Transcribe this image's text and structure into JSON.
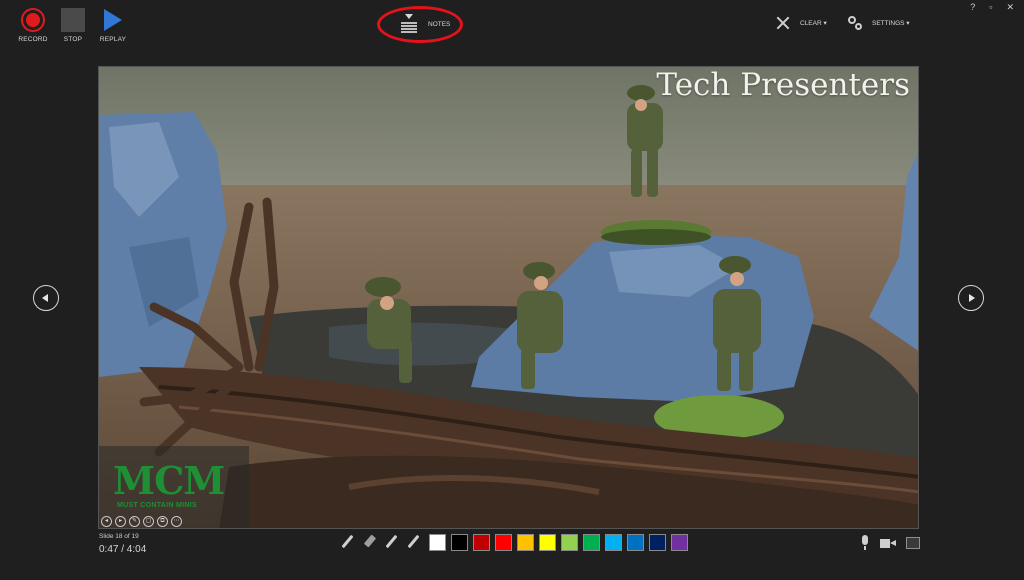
{
  "toolbar": {
    "record_label": "RECORD",
    "stop_label": "STOP",
    "replay_label": "REPLAY",
    "notes_label": "NOTES",
    "clear_label": "CLEAR ▾",
    "settings_label": "SETTINGS ▾",
    "window_controls": [
      "?",
      "▫",
      "✕"
    ]
  },
  "slide": {
    "title": "Tech Presenters",
    "logo_text": "MCM",
    "logo_subtext": "MUST CONTAIN MINIS",
    "mini_controls": [
      "◂",
      "▸",
      "✎",
      "▢",
      "⧉",
      "⋯"
    ]
  },
  "status": {
    "slide_counter": "Slide 18 of 19",
    "timer": "0:47  /  4:04"
  },
  "colors": {
    "record": "#e01b1b",
    "replay": "#2f78d6",
    "highlight": "#e3121b",
    "logo_green": "#1e8f35"
  },
  "ink_swatches": [
    "#ffffff",
    "#000000",
    "#c00000",
    "#ff0000",
    "#ffc000",
    "#ffff00",
    "#92d050",
    "#00b050",
    "#00b0f0",
    "#0070c0",
    "#002060",
    "#7030a0"
  ],
  "icons": {
    "record": "record-icon",
    "stop": "stop-icon",
    "replay": "replay-icon",
    "notes": "notes-icon",
    "clear": "close-icon",
    "settings": "gear-icon",
    "prev": "chevron-left-icon",
    "next": "chevron-right-icon",
    "pen_tools": [
      "laser-pointer-icon",
      "eraser-icon",
      "pen-icon",
      "highlighter-icon"
    ],
    "mic": "microphone-icon",
    "camera": "camera-icon",
    "camera_preview": "camera-preview-icon"
  }
}
